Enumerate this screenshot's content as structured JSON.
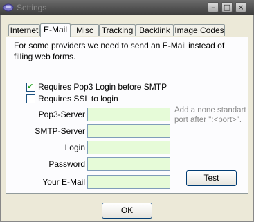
{
  "window": {
    "title": "Settings"
  },
  "tabs": [
    {
      "label": "Internet"
    },
    {
      "label": "E-Mail"
    },
    {
      "label": "Misc"
    },
    {
      "label": "Tracking"
    },
    {
      "label": "Backlink"
    },
    {
      "label": "Image Codes"
    }
  ],
  "active_tab": "E-Mail",
  "panel": {
    "info": "For some providers we need to send an E-Mail instead of filling web forms.",
    "pop3_checkbox": {
      "label": "Requires Pop3 Login before SMTP",
      "checked": true
    },
    "ssl_checkbox": {
      "label": "Requires SSL to login",
      "checked": false
    },
    "fields": [
      {
        "label": "Pop3-Server",
        "value": ""
      },
      {
        "label": "SMTP-Server",
        "value": ""
      },
      {
        "label": "Login",
        "value": ""
      },
      {
        "label": "Password",
        "value": ""
      },
      {
        "label": "Your E-Mail",
        "value": ""
      }
    ],
    "hint": "Add a none standart port after \":<port>\".",
    "test_button": "Test"
  },
  "ok_button": "OK",
  "colors": {
    "field_bg": "#e6fbd8",
    "window_bg": "#ece9d8",
    "titlebar": "#4a4a4a"
  }
}
